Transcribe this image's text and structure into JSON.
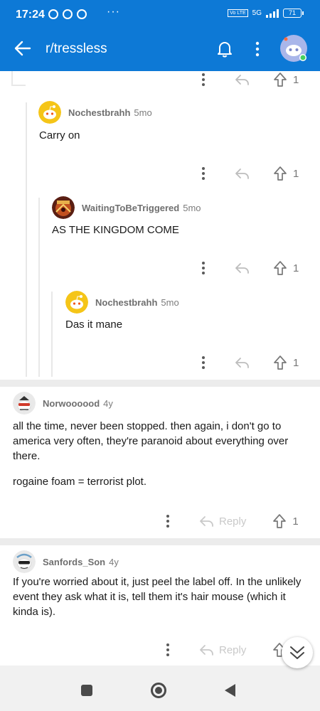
{
  "status_bar": {
    "time": "17:24",
    "dots": "···",
    "network": "5G",
    "volte": "Vo LTE",
    "battery": "71"
  },
  "header": {
    "title": "r/tressless"
  },
  "comments": [
    {
      "actions": {
        "count": "1"
      }
    },
    {
      "user": "Nochestbrahh",
      "age": "5mo",
      "text": "Carry on",
      "actions": {
        "count": "1"
      }
    },
    {
      "user": "WaitingToBeTriggered",
      "age": "5mo",
      "text": "AS THE KINGDOM COME",
      "actions": {
        "count": "1"
      }
    },
    {
      "user": "Nochestbrahh",
      "age": "5mo",
      "text": "Das it mane",
      "actions": {
        "count": "1"
      }
    },
    {
      "user": "Norwoooood",
      "age": "4y",
      "text": "all the time, never been stopped. then again, i don't go to america very often, they're paranoid about everything over there.",
      "text2": "rogaine foam = terrorist plot.",
      "actions": {
        "reply": "Reply",
        "count": "1"
      }
    },
    {
      "user": "Sanfords_Son",
      "age": "4y",
      "text": "If you're worried about it, just peel the label off. In the unlikely event they ask what it is, tell them it's hair mouse (which it kinda is).",
      "actions": {
        "reply": "Reply"
      }
    }
  ],
  "colors": {
    "header_bg": "#0d79d6",
    "snoo_yellow": "#f5c518",
    "online_dot": "#46d160"
  },
  "icons": [
    "back-arrow-icon",
    "bell-icon",
    "more-vertical-icon",
    "reply-arrow-icon",
    "upvote-arrow-icon",
    "chevron-down-icon",
    "nav-square-icon",
    "nav-home-icon",
    "nav-back-icon"
  ]
}
